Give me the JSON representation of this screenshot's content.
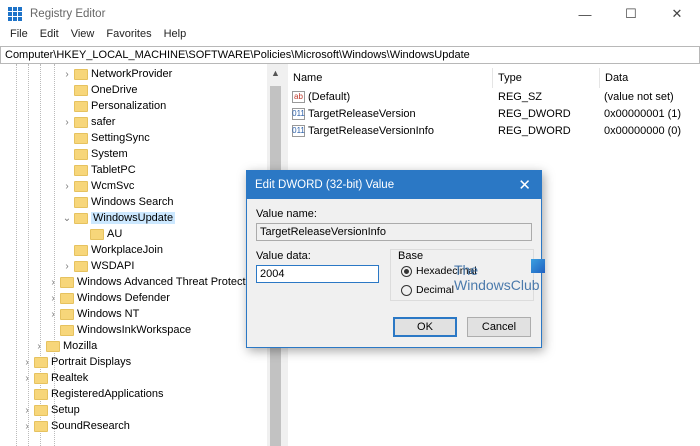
{
  "window": {
    "title": "Registry Editor",
    "minimize": "—",
    "maximize": "☐",
    "close": "✕"
  },
  "menu": [
    "File",
    "Edit",
    "View",
    "Favorites",
    "Help"
  ],
  "address": "Computer\\HKEY_LOCAL_MACHINE\\SOFTWARE\\Policies\\Microsoft\\Windows\\WindowsUpdate",
  "tree": [
    {
      "label": "NetworkProvider",
      "level": 4,
      "expand": ">"
    },
    {
      "label": "OneDrive",
      "level": 4,
      "expand": ""
    },
    {
      "label": "Personalization",
      "level": 4,
      "expand": ""
    },
    {
      "label": "safer",
      "level": 4,
      "expand": ">"
    },
    {
      "label": "SettingSync",
      "level": 4,
      "expand": ""
    },
    {
      "label": "System",
      "level": 4,
      "expand": ""
    },
    {
      "label": "TabletPC",
      "level": 4,
      "expand": ""
    },
    {
      "label": "WcmSvc",
      "level": 4,
      "expand": ">"
    },
    {
      "label": "Windows Search",
      "level": 4,
      "expand": ""
    },
    {
      "label": "WindowsUpdate",
      "level": 4,
      "expand": "v",
      "selected": true
    },
    {
      "label": "AU",
      "level": 5,
      "expand": ""
    },
    {
      "label": "WorkplaceJoin",
      "level": 4,
      "expand": ""
    },
    {
      "label": "WSDAPI",
      "level": 4,
      "expand": ">"
    },
    {
      "label": "Windows Advanced Threat Protection",
      "level": 3,
      "expand": ">"
    },
    {
      "label": "Windows Defender",
      "level": 3,
      "expand": ">"
    },
    {
      "label": "Windows NT",
      "level": 3,
      "expand": ">"
    },
    {
      "label": "WindowsInkWorkspace",
      "level": 3,
      "expand": ""
    },
    {
      "label": "Mozilla",
      "level": 2,
      "expand": ">"
    },
    {
      "label": "Portrait Displays",
      "level": 1,
      "expand": ">"
    },
    {
      "label": "Realtek",
      "level": 1,
      "expand": ">"
    },
    {
      "label": "RegisteredApplications",
      "level": 1,
      "expand": ""
    },
    {
      "label": "Setup",
      "level": 1,
      "expand": ">"
    },
    {
      "label": "SoundResearch",
      "level": 1,
      "expand": ">"
    }
  ],
  "columns": {
    "name": "Name",
    "type": "Type",
    "data": "Data"
  },
  "values": [
    {
      "icon": "ab",
      "name": "(Default)",
      "type": "REG_SZ",
      "data": "(value not set)"
    },
    {
      "icon": "011",
      "name": "TargetReleaseVersion",
      "type": "REG_DWORD",
      "data": "0x00000001 (1)"
    },
    {
      "icon": "011",
      "name": "TargetReleaseVersionInfo",
      "type": "REG_DWORD",
      "data": "0x00000000 (0)"
    }
  ],
  "dialog": {
    "title": "Edit DWORD (32-bit) Value",
    "value_name_label": "Value name:",
    "value_name": "TargetReleaseVersionInfo",
    "value_data_label": "Value data:",
    "value_data": "2004",
    "base_label": "Base",
    "hex_label": "Hexadecimal",
    "dec_label": "Decimal",
    "ok": "OK",
    "cancel": "Cancel",
    "close": "✕"
  },
  "watermark": {
    "line1": "The",
    "line2": "WindowsClub"
  },
  "accent": "#2b78c5"
}
